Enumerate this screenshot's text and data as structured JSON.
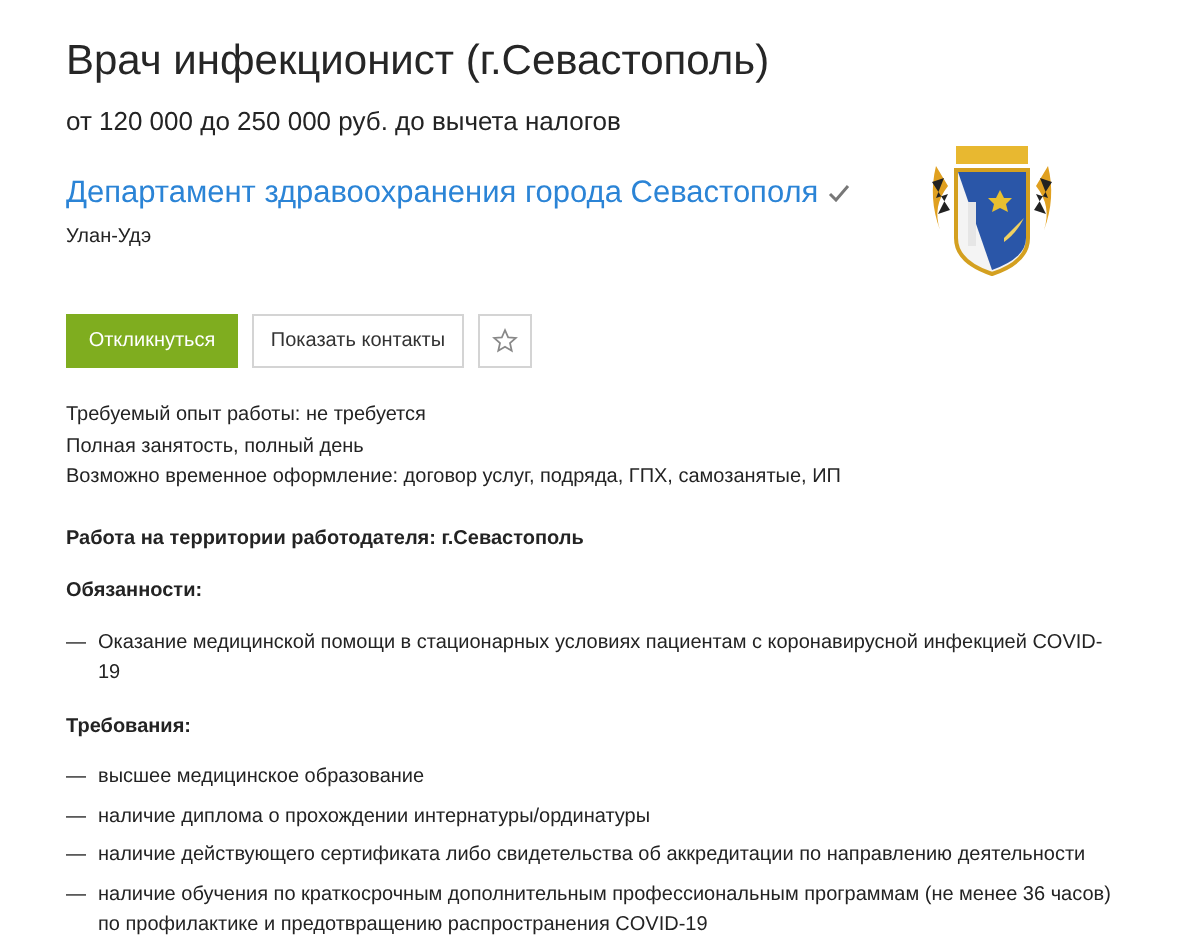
{
  "vacancy": {
    "title": "Врач инфекционист (г.Севастополь)",
    "salary": "от 120 000 до 250 000 руб. до вычета налогов"
  },
  "company": {
    "name": "Департамент здравоохранения города Севастополя",
    "verified": true,
    "city": "Улан-Удэ"
  },
  "actions": {
    "respond": "Откликнуться",
    "contacts": "Показать контакты",
    "favorite": false
  },
  "details": [
    "Требуемый опыт работы: не требуется",
    "Полная занятость, полный день",
    "Возможно временное оформление: договор услуг, подряда, ГПХ, самозанятые, ИП"
  ],
  "work_place": "Работа на территории работодателя: г.Севастополь",
  "sections": [
    {
      "heading": "Обязанности:",
      "items": [
        {
          "marker": "—",
          "text": "Оказание медицинской помощи в стационарных условиях пациентам с коронавирусной инфекцией COVID-19"
        }
      ]
    },
    {
      "heading": "Требования:",
      "items": [
        {
          "marker": "—",
          "text": "высшее медицинское образование"
        },
        {
          "marker": "—",
          "text": "наличие диплома о прохождении интернатуры/ординатуры"
        },
        {
          "marker": "—",
          "text": "наличие действующего сертификата либо свидетельства об аккредитации по направлению деятельности"
        },
        {
          "marker": "—",
          "text": "наличие обучения по краткосрочным дополнительным профессиональным программам (не менее 36 часов) по профилактике и предотвращению распространения COVID-19"
        }
      ]
    }
  ]
}
